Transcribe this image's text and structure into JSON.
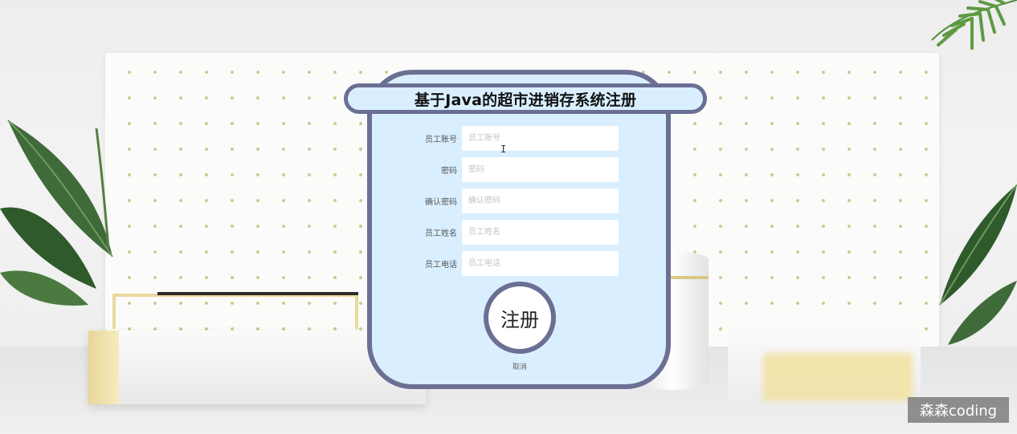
{
  "form": {
    "title": "基于Java的超市进销存系统注册",
    "fields": [
      {
        "label": "员工账号",
        "placeholder": "员工账号",
        "value": ""
      },
      {
        "label": "密码",
        "placeholder": "密码",
        "value": ""
      },
      {
        "label": "确认密码",
        "placeholder": "确认密码",
        "value": ""
      },
      {
        "label": "员工姓名",
        "placeholder": "员工姓名",
        "value": ""
      },
      {
        "label": "员工电话",
        "placeholder": "员工电话",
        "value": ""
      }
    ],
    "register_label": "注册",
    "cancel_label": "取消"
  },
  "watermark": "森森coding",
  "colors": {
    "card_border": "#6c6f94",
    "card_fill": "#d9efff",
    "input_bg": "#ffffff",
    "pegboard_dot": "#cfc48e"
  }
}
